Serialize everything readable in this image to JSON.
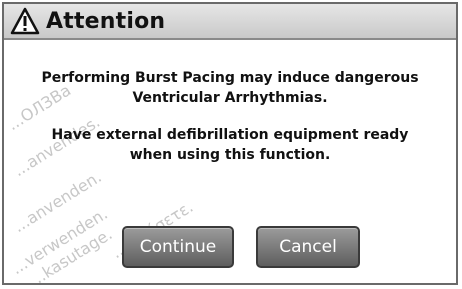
{
  "dialog": {
    "title": "Attention",
    "icon": "warning-triangle-icon",
    "message_line_1": "Performing Burst Pacing may induce dangerous",
    "message_line_2": "Ventricular Arrhythmias.",
    "message_line_3": "Have external defibrillation equipment ready",
    "message_line_4": "when using this function."
  },
  "buttons": {
    "continue_label": "Continue",
    "cancel_label": "Cancel"
  },
  "watermarks": {
    "w1": "...ОЛЗВа",
    "w2": "...anvendes.",
    "w3": "...anvenden.",
    "w4": "...verwenden.",
    "w5": "...kasutage.",
    "w6": "...ποιήσετε."
  },
  "colors": {
    "titlebar": "#d6d6d6",
    "button": "#7a7a7a",
    "text": "#111111",
    "watermark": "#b5b5b5"
  }
}
